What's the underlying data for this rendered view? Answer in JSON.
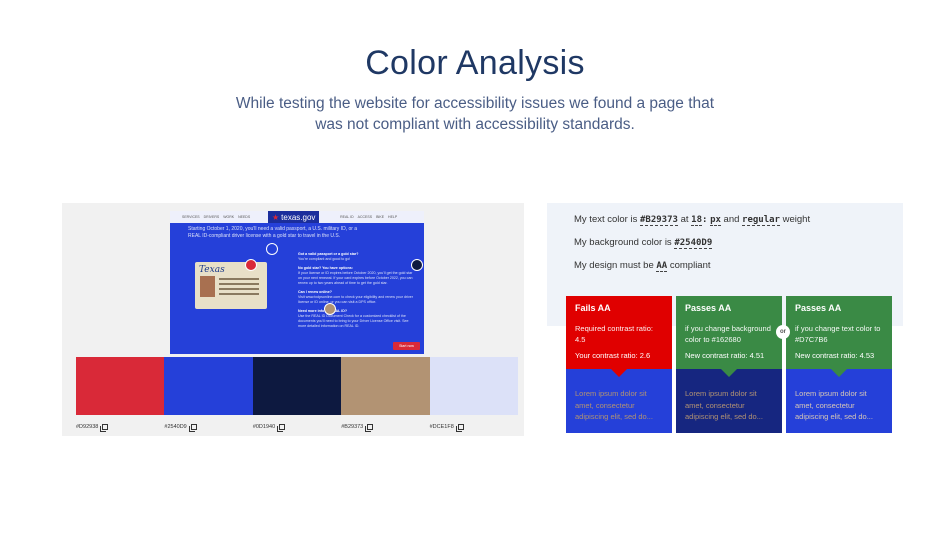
{
  "header": {
    "title": "Color Analysis",
    "subtitle": "While testing the website for accessibility issues we found a page that was not compliant with accessibility standards."
  },
  "screenshot": {
    "nav_items": [
      "SERVICES",
      "DRIVERS",
      "WORK",
      "NEEDS",
      "",
      "",
      "",
      "",
      "REAL ID",
      "ACCESS",
      "BIKE",
      "HELP"
    ],
    "logo": "texas.gov",
    "lead": "Starting October 1, 2020, you'll need a valid passport, a U.S. military ID, or a REAL ID-compliant driver license with a gold star to travel in the U.S.",
    "card_title": "Texas",
    "sections": [
      {
        "head": "Got a valid passport or a gold star?",
        "body": "You're compliant and good to go!"
      },
      {
        "head": "No gold star? You have options:",
        "body": "If your license or ID expires before October 2020, you'll get the gold star on your next renewal. If your card expires before October 2022, you can renew up to two years ahead of time to get the gold star."
      },
      {
        "head": "Can I renew online?",
        "body": "Visit www.txdpsonline.com to check your eligibility and renew your driver license or ID online, or you can visit a DPS office."
      },
      {
        "head": "Need more info on REAL ID?",
        "body": "Use the REAL ID Document Check for a customized checklist of the documents you'll need to bring to your Driver License Office visit. See more detailed information on REAL ID."
      }
    ],
    "button": "Start now"
  },
  "palette": [
    {
      "hex": "#D92938",
      "color": "#d92938"
    },
    {
      "hex": "#2540D9",
      "color": "#2540d9"
    },
    {
      "hex": "#0D1940",
      "color": "#0d1940"
    },
    {
      "hex": "#B29373",
      "color": "#b29373"
    },
    {
      "hex": "#DCE1F8",
      "color": "#dce1f8"
    }
  ],
  "settings": {
    "text_color_prefix": "My text color is",
    "text_color": "#B29373",
    "at": "at",
    "size": "18",
    "size_sep": ":",
    "unit": "px",
    "and": "and",
    "weight_value": "regular",
    "weight_suffix": "weight",
    "bg_prefix": "My background color is",
    "bg_color": "#2540D9",
    "design_prefix": "My design must be",
    "level": "AA",
    "design_suffix": "compliant"
  },
  "results": [
    {
      "head": "Fails AA",
      "detail": "Required contrast ratio: 4.5",
      "stat": "Your contrast ratio: 2.6",
      "sample": "Lorem ipsum dolor sit amet, consectetur adipiscing elit, sed do...",
      "top_color": "#e00000",
      "bottom_color": "#2540d9",
      "sample_color": "#b29373"
    },
    {
      "head": "Passes AA",
      "detail": "if you change background color to #162680",
      "stat": "New contrast ratio: 4.51",
      "sample": "Lorem ipsum dolor sit amet, consectetur adipiscing elit, sed do...",
      "top_color": "#3a8a45",
      "bottom_color": "#162680",
      "sample_color": "#b29373"
    },
    {
      "head": "Passes AA",
      "detail": "if you change text color to #D7C7B6",
      "stat": "New contrast ratio: 4.53",
      "sample": "Lorem ipsum dolor sit amet, consectetur adipiscing elit, sed do...",
      "top_color": "#3a8a45",
      "bottom_color": "#2540d9",
      "sample_color": "#d7c7b6"
    }
  ],
  "or_label": "or",
  "icons": {
    "copy": "copy-icon",
    "picker": "color-picker-dot"
  }
}
